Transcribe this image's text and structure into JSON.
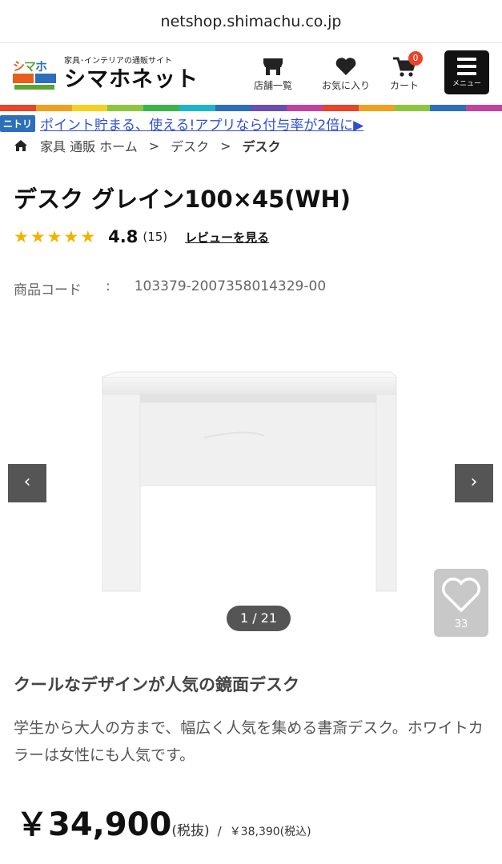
{
  "browser": {
    "url": "netshop.shimachu.co.jp"
  },
  "header": {
    "tagline": "家具･インテリアの通販サイト",
    "site_name": "シマホネット",
    "logo_mark": [
      "シ",
      "マ",
      "ホ"
    ],
    "store_label": "店舗一覧",
    "favorites_label": "お気に入り",
    "cart_label": "カート",
    "cart_count": "0",
    "menu_label": "メニュー"
  },
  "promo": {
    "badge": "ニトリ",
    "text": "ポイント貯まる、使える!アプリなら付与率が2倍に▶"
  },
  "breadcrumb": {
    "items": [
      "家具 通販 ホーム",
      "デスク",
      "デスク"
    ],
    "separator": ">"
  },
  "product": {
    "title": "デスク グレイン100×45(WH)",
    "rating": "4.8",
    "rating_stars": 5,
    "review_count": "(15)",
    "review_link": "レビューを見る",
    "code_label": "商品コード",
    "code_colon": ":",
    "code_value": "103379-2007358014329-00"
  },
  "gallery": {
    "pager": "1 / 21",
    "like_count": "33"
  },
  "description": {
    "heading": "クールなデザインが人気の鏡面デスク",
    "body": "学生から大人の方まで、幅広く人気を集める書斎デスク。ホワイトカラーは女性にも人気です。"
  },
  "price": {
    "main": "￥34,900",
    "tax_note": "(税抜)",
    "slash": "/",
    "incl": "￥38,390(税込)"
  },
  "colors": {
    "rainbow": [
      "#e8442a",
      "#f0a020",
      "#f5d020",
      "#8cc63f",
      "#3bb54a",
      "#1fb5c8",
      "#2d6fba",
      "#6a4fb0",
      "#c2439a",
      "#e8442a",
      "#f0a020",
      "#8cc63f",
      "#2d6fba",
      "#c2439a"
    ],
    "accent_blue": "#2d4fd4",
    "star": "#f0b400"
  }
}
